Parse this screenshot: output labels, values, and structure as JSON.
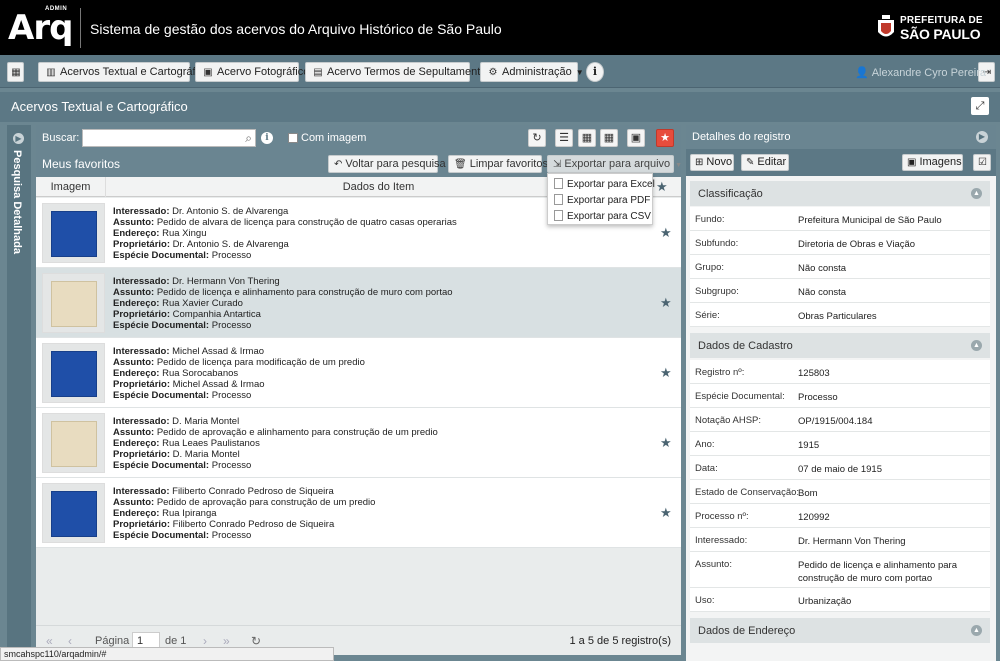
{
  "header": {
    "logo_admin": "ADMIN",
    "logo_text": "Arq",
    "system_title": "Sistema de gestão dos acervos do Arquivo Histórico de São Paulo",
    "brand_line1": "PREFEITURA DE",
    "brand_line2": "SÃO PAULO"
  },
  "nav": {
    "items": [
      {
        "label": "Acervos Textual e Cartográfico",
        "icon": "columns-icon"
      },
      {
        "label": "Acervo Fotográfico",
        "icon": "photo-icon"
      },
      {
        "label": "Acervo Termos de Sepultamento",
        "icon": "document-icon"
      }
    ],
    "admin": {
      "label": "Administração",
      "icon": "gear-icon"
    },
    "user": "Alexandre Cyro Pereira"
  },
  "section": {
    "title": "Acervos Textual e Cartográfico",
    "side_panel_label": "Pesquisa Detalhada"
  },
  "search": {
    "label": "Buscar:",
    "value": "",
    "with_image_label": "Com imagem"
  },
  "favorites": {
    "title": "Meus favoritos",
    "back_button": "Voltar para pesquisa",
    "clear_button": "Limpar favoritos",
    "export_button": "Exportar para arquivo",
    "export_options": [
      "Exportar para Excel",
      "Exportar para PDF",
      "Exportar para CSV"
    ]
  },
  "table": {
    "col_image": "Imagem",
    "col_data": "Dados do Item",
    "labels": {
      "interessado": "Interessado:",
      "assunto": "Assunto:",
      "endereco": "Endereço:",
      "proprietario": "Proprietário:",
      "especie": "Espécie Documental:"
    },
    "rows": [
      {
        "interessado": "Dr. Antonio S. de Alvarenga",
        "assunto": "Pedido de alvara de licença para construção de quatro casas operarias",
        "endereco": "Rua Xingu",
        "proprietario": "Dr. Antonio S. de Alvarenga",
        "especie": "Processo",
        "thumb": "blue"
      },
      {
        "interessado": "Dr. Hermann Von Thering",
        "assunto": "Pedido de licença e alinhamento para construção de muro com portao",
        "endereco": "Rua Xavier Curado",
        "proprietario": "Companhia Antartica",
        "especie": "Processo",
        "thumb": "paper"
      },
      {
        "interessado": "Michel Assad & Irmao",
        "assunto": "Pedido de licença para modificação de um predio",
        "endereco": "Rua Sorocabanos",
        "proprietario": "Michel Assad & Irmao",
        "especie": "Processo",
        "thumb": "blue"
      },
      {
        "interessado": "D. Maria Montel",
        "assunto": "Pedido de aprovação e alinhamento para construção de um predio",
        "endereco": "Rua Leaes Paulistanos",
        "proprietario": "D. Maria Montel",
        "especie": "Processo",
        "thumb": "paper"
      },
      {
        "interessado": "Filiberto Conrado Pedroso de Siqueira",
        "assunto": "Pedido de aprovação para construção de um predio",
        "endereco": "Rua Ipiranga",
        "proprietario": "Filiberto Conrado Pedroso de Siqueira",
        "especie": "Processo",
        "thumb": "blue"
      }
    ]
  },
  "pager": {
    "page_label": "Página",
    "page_value": "1",
    "of_label": "de 1",
    "count": "1 a 5 de 5 registro(s)"
  },
  "details": {
    "title": "Detalhes do registro",
    "new_button": "Novo",
    "edit_button": "Editar",
    "images_button": "Imagens",
    "sections": {
      "classificacao": "Classificação",
      "cadastro": "Dados de Cadastro",
      "endereco": "Dados de Endereço"
    },
    "classificacao": [
      {
        "k": "Fundo:",
        "v": "Prefeitura Municipal de São Paulo"
      },
      {
        "k": "Subfundo:",
        "v": "Diretoria de Obras e Viação"
      },
      {
        "k": "Grupo:",
        "v": "Não consta"
      },
      {
        "k": "Subgrupo:",
        "v": "Não consta"
      },
      {
        "k": "Série:",
        "v": "Obras Particulares"
      }
    ],
    "cadastro": [
      {
        "k": "Registro nº:",
        "v": "125803"
      },
      {
        "k": "Espécie Documental:",
        "v": "Processo"
      },
      {
        "k": "Notação AHSP:",
        "v": "OP/1915/004.184"
      },
      {
        "k": "Ano:",
        "v": "1915"
      },
      {
        "k": "Data:",
        "v": "07 de maio de 1915"
      },
      {
        "k": "Estado de Conservação:",
        "v": "Bom"
      },
      {
        "k": "Processo nº:",
        "v": "120992"
      },
      {
        "k": "Interessado:",
        "v": "Dr. Hermann Von Thering"
      },
      {
        "k": "Assunto:",
        "v": "Pedido de licença e alinhamento para construção de muro com portao"
      },
      {
        "k": "Uso:",
        "v": "Urbanização"
      }
    ]
  },
  "status_url": "smcahspc110/arqadmin/#",
  "colors": {
    "header": "#000000",
    "nav": "#5c7885",
    "panel": "#6a8591",
    "star_active": "#e74c3c"
  }
}
